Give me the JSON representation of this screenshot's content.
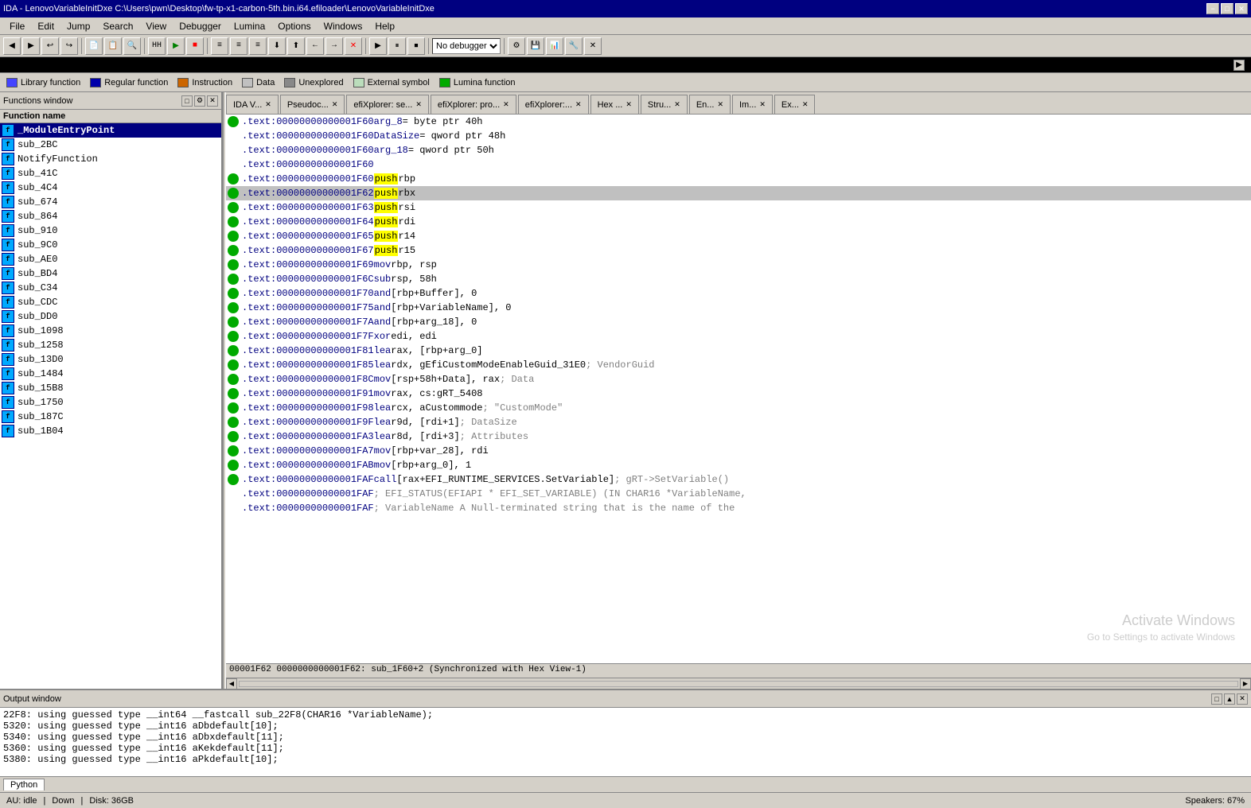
{
  "titlebar": {
    "title": "IDA - LenovoVariableInitDxe C:\\Users\\pwn\\Desktop\\fw-tp-x1-carbon-5th.bin.i64.efiloader\\LenovoVariableInitDxe",
    "min_label": "−",
    "max_label": "□",
    "close_label": "✕"
  },
  "menu": {
    "items": [
      "File",
      "Edit",
      "Jump",
      "Search",
      "View",
      "Debugger",
      "Lumina",
      "Options",
      "Windows",
      "Help"
    ]
  },
  "toolbar": {
    "debugger_placeholder": "No debugger"
  },
  "legend": {
    "items": [
      {
        "label": "Library function",
        "color": "#4444ff"
      },
      {
        "label": "Regular function",
        "color": "#0000aa"
      },
      {
        "label": "Instruction",
        "color": "#cc6600"
      },
      {
        "label": "Data",
        "color": "#d4d0c8"
      },
      {
        "label": "Unexplored",
        "color": "#888888"
      },
      {
        "label": "External symbol",
        "color": "#44bb44"
      },
      {
        "label": "Lumina function",
        "color": "#00aa00"
      }
    ]
  },
  "functions_panel": {
    "title": "Functions window",
    "header": "Function name",
    "items": [
      {
        "name": "_ModuleEntryPoint",
        "bold": true
      },
      {
        "name": "sub_2BC",
        "bold": false
      },
      {
        "name": "NotifyFunction",
        "bold": false
      },
      {
        "name": "sub_41C",
        "bold": false
      },
      {
        "name": "sub_4C4",
        "bold": false
      },
      {
        "name": "sub_674",
        "bold": false
      },
      {
        "name": "sub_864",
        "bold": false
      },
      {
        "name": "sub_910",
        "bold": false
      },
      {
        "name": "sub_9C0",
        "bold": false
      },
      {
        "name": "sub_AE0",
        "bold": false
      },
      {
        "name": "sub_BD4",
        "bold": false
      },
      {
        "name": "sub_C34",
        "bold": false
      },
      {
        "name": "sub_CDC",
        "bold": false
      },
      {
        "name": "sub_DD0",
        "bold": false
      },
      {
        "name": "sub_1098",
        "bold": false
      },
      {
        "name": "sub_1258",
        "bold": false
      },
      {
        "name": "sub_13D0",
        "bold": false
      },
      {
        "name": "sub_1484",
        "bold": false
      },
      {
        "name": "sub_15B8",
        "bold": false
      },
      {
        "name": "sub_1750",
        "bold": false
      },
      {
        "name": "sub_187C",
        "bold": false
      },
      {
        "name": "sub_1B04",
        "bold": false
      }
    ]
  },
  "tabs": [
    {
      "label": "IDA V...",
      "active": false,
      "closeable": true,
      "color": ""
    },
    {
      "label": "Pseudoc...",
      "active": false,
      "closeable": true
    },
    {
      "label": "efiXplorer: se...",
      "active": false,
      "closeable": true
    },
    {
      "label": "efiXplorer: pro...",
      "active": false,
      "closeable": true
    },
    {
      "label": "efiXplorer:...",
      "active": false,
      "closeable": true
    },
    {
      "label": "Hex ...",
      "active": false,
      "closeable": true
    },
    {
      "label": "Stru...",
      "active": false,
      "closeable": true
    },
    {
      "label": "En...",
      "active": false,
      "closeable": true
    },
    {
      "label": "Im...",
      "active": false,
      "closeable": true
    },
    {
      "label": "Ex...",
      "active": false,
      "closeable": true
    }
  ],
  "code": {
    "lines": [
      {
        "addr": ".text:00000000000001F60",
        "label": "arg_8",
        "equals": "= byte ptr  40h",
        "bullet": true,
        "highlight": false
      },
      {
        "addr": ".text:00000000000001F60",
        "label": "DataSize",
        "equals": "= qword ptr 48h",
        "bullet": false,
        "highlight": false
      },
      {
        "addr": ".text:00000000000001F60",
        "label": "arg_18",
        "equals": "= qword ptr  50h",
        "bullet": false,
        "highlight": false
      },
      {
        "addr": ".text:00000000000001F60",
        "label": "",
        "equals": "",
        "bullet": false,
        "highlight": false
      },
      {
        "addr": ".text:00000000000001F60",
        "mnemonic": "push",
        "operand": "rbp",
        "kw": true,
        "bullet": true,
        "highlight": false
      },
      {
        "addr": ".text:00000000000001F62",
        "mnemonic": "push",
        "operand": "rbx",
        "kw": true,
        "bullet": true,
        "highlight": true
      },
      {
        "addr": ".text:00000000000001F63",
        "mnemonic": "push",
        "operand": "rsi",
        "kw": true,
        "bullet": true,
        "highlight": false
      },
      {
        "addr": ".text:00000000000001F64",
        "mnemonic": "push",
        "operand": "rdi",
        "kw": true,
        "bullet": true,
        "highlight": false
      },
      {
        "addr": ".text:00000000000001F65",
        "mnemonic": "push",
        "operand": "r14",
        "kw": true,
        "bullet": true,
        "highlight": false
      },
      {
        "addr": ".text:00000000000001F67",
        "mnemonic": "push",
        "operand": "r15",
        "kw": true,
        "bullet": true,
        "highlight": false
      },
      {
        "addr": ".text:00000000000001F69",
        "mnemonic": "mov",
        "operand": "rbp, rsp",
        "kw": false,
        "bullet": true,
        "highlight": false
      },
      {
        "addr": ".text:00000000000001F6C",
        "mnemonic": "sub",
        "operand": "rsp, 58h",
        "kw": false,
        "bullet": true,
        "highlight": false
      },
      {
        "addr": ".text:00000000000001F70",
        "mnemonic": "and",
        "operand": "[rbp+Buffer], 0",
        "kw": false,
        "bullet": true,
        "highlight": false
      },
      {
        "addr": ".text:00000000000001F75",
        "mnemonic": "and",
        "operand": "[rbp+VariableName], 0",
        "kw": false,
        "bullet": true,
        "highlight": false
      },
      {
        "addr": ".text:00000000000001F7A",
        "mnemonic": "and",
        "operand": "[rbp+arg_18], 0",
        "kw": false,
        "bullet": true,
        "highlight": false
      },
      {
        "addr": ".text:00000000000001F7F",
        "mnemonic": "xor",
        "operand": "edi, edi",
        "kw": false,
        "bullet": true,
        "highlight": false
      },
      {
        "addr": ".text:00000000000001F81",
        "mnemonic": "lea",
        "operand": "rax, [rbp+arg_0]",
        "kw": false,
        "bullet": true,
        "highlight": false
      },
      {
        "addr": ".text:00000000000001F85",
        "mnemonic": "lea",
        "operand": "rdx, gEfiCustomModeEnableGuid_31E0 ; VendorGuid",
        "kw": false,
        "bullet": true,
        "highlight": false
      },
      {
        "addr": ".text:00000000000001F8C",
        "mnemonic": "mov",
        "operand": "[rsp+58h+Data], rax ; Data",
        "kw": false,
        "bullet": true,
        "highlight": false
      },
      {
        "addr": ".text:00000000000001F91",
        "mnemonic": "mov",
        "operand": "rax, cs:gRT_5408",
        "kw": false,
        "bullet": true,
        "highlight": false
      },
      {
        "addr": ".text:00000000000001F98",
        "mnemonic": "lea",
        "operand": "rcx, aCustommode ; \"CustomMode\"",
        "kw": false,
        "bullet": true,
        "highlight": false
      },
      {
        "addr": ".text:00000000000001F9F",
        "mnemonic": "lea",
        "operand": "r9d, [rdi+1]   ; DataSize",
        "kw": false,
        "bullet": true,
        "highlight": false
      },
      {
        "addr": ".text:00000000000001FA3",
        "mnemonic": "lea",
        "operand": "r8d, [rdi+3]   ; Attributes",
        "kw": false,
        "bullet": true,
        "highlight": false
      },
      {
        "addr": ".text:00000000000001FA7",
        "mnemonic": "mov",
        "operand": "[rbp+var_28], rdi",
        "kw": false,
        "bullet": true,
        "highlight": false
      },
      {
        "addr": ".text:00000000000001FAB",
        "mnemonic": "mov",
        "operand": "[rbp+arg_0], 1",
        "kw": false,
        "bullet": true,
        "highlight": false
      },
      {
        "addr": ".text:00000000000001FAF",
        "mnemonic": "call",
        "operand": "[rax+EFI_RUNTIME_SERVICES.SetVariable] ; gRT->SetVariable()",
        "kw": false,
        "bullet": true,
        "highlight": false
      },
      {
        "addr": ".text:00000000000001FAF",
        "label": "",
        "equals": "; EFI_STATUS(EFIAPI * EFI_SET_VARIABLE) (IN CHAR16 *VariableName,",
        "comment": true,
        "bullet": false,
        "highlight": false
      },
      {
        "addr": ".text:00000000000001FAF",
        "label": "",
        "equals": "; VariableName   A Null-terminated string that is the name of the",
        "comment": true,
        "bullet": false,
        "highlight": false
      }
    ],
    "status_line": "00001F62 0000000000001F62: sub_1F60+2 (Synchronized with Hex View-1)"
  },
  "output": {
    "title": "Output window",
    "lines": [
      "22F8: using guessed type __int64 __fastcall sub_22F8(CHAR16 *VariableName);",
      "5320: using guessed type __int16 aDbdefault[10];",
      "5340: using guessed type __int16 aDbxdefault[11];",
      "5360: using guessed type __int16 aKekdefault[11];",
      "5380: using guessed type __int16 aPkdefault[10];"
    ],
    "tab": "Python"
  },
  "statusbar": {
    "mode": "AU: idle",
    "direction": "Down",
    "disk": "Disk: 36GB",
    "speaker": "Speakers: 67%"
  },
  "watermark": {
    "line1": "Activate Windows",
    "line2": "Go to Settings to activate Windows"
  }
}
